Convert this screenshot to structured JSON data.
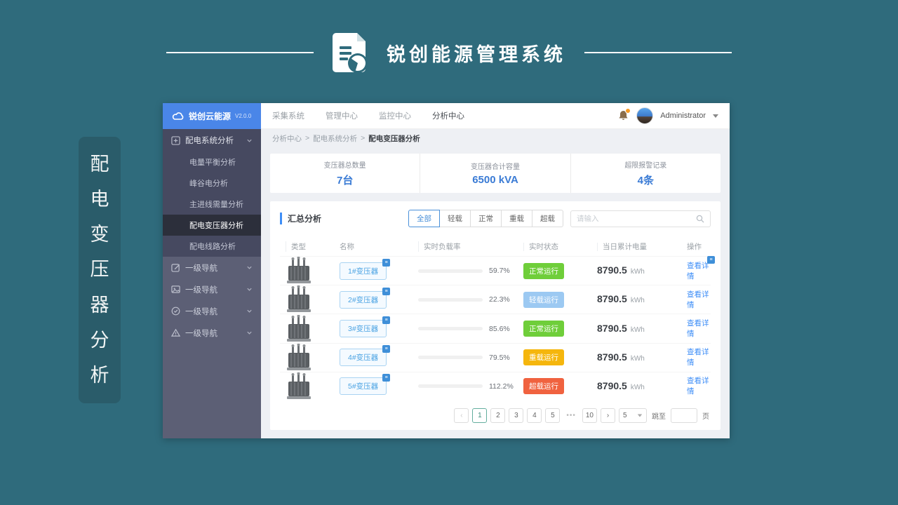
{
  "banner": {
    "title": "锐创能源管理系统"
  },
  "side_tag": {
    "chars": [
      "配",
      "电",
      "变",
      "压",
      "器",
      "分",
      "析"
    ]
  },
  "colors": {
    "page_bg": "#2f6b7c",
    "accent_blue": "#3e8ef7",
    "stat_blue": "#3a7bd5",
    "sidebar_logo": "#4a86e8",
    "status_normal": "#6fce3a",
    "status_light": "#9cc9f2",
    "status_heavy": "#f5b60d",
    "status_over": "#f0623f",
    "pager_active": "#63ae9e"
  },
  "sidebar": {
    "logo": {
      "name": "锐创云能源",
      "version": "V2.0.0"
    },
    "group": {
      "label": "配电系统分析",
      "children": [
        "电量平衡分析",
        "峰谷电分析",
        "主进线需量分析",
        "配电变压器分析",
        "配电线路分析"
      ],
      "active": "配电变压器分析"
    },
    "nav_items": [
      "一级导航",
      "一级导航",
      "一级导航",
      "一级导航"
    ]
  },
  "topnav": {
    "items": [
      "采集系统",
      "管理中心",
      "监控中心",
      "分析中心"
    ],
    "active": "分析中心",
    "user": "Administrator"
  },
  "breadcrumb": {
    "items": [
      "分析中心",
      "配电系统分析",
      "配电变压器分析"
    ],
    "separator": ">"
  },
  "stats": [
    {
      "label": "变压器总数量",
      "value": "7台"
    },
    {
      "label": "变压器合计容量",
      "value": "6500 kVA"
    },
    {
      "label": "超限报警记录",
      "value": "4条"
    }
  ],
  "summary": {
    "title": "汇总分析",
    "filters": [
      "全部",
      "轻载",
      "正常",
      "重载",
      "超载"
    ],
    "active_filter": "全部",
    "search_placeholder": "请输入",
    "table": {
      "headers": [
        "类型",
        "名称",
        "实时负载率",
        "实时状态",
        "当日累计电量",
        "操作"
      ],
      "rows": [
        {
          "name": "1#变压器",
          "load": "59.7%",
          "load_pct": 59.7,
          "status": "正常运行",
          "status_type": "normal",
          "energy": "8790.5",
          "unit": "kWh",
          "action": "查看详情"
        },
        {
          "name": "2#变压器",
          "load": "22.3%",
          "load_pct": 22.3,
          "status": "轻载运行",
          "status_type": "light",
          "energy": "8790.5",
          "unit": "kWh",
          "action": "查看详情"
        },
        {
          "name": "3#变压器",
          "load": "85.6%",
          "load_pct": 85.6,
          "status": "正常运行",
          "status_type": "normal",
          "energy": "8790.5",
          "unit": "kWh",
          "action": "查看详情"
        },
        {
          "name": "4#变压器",
          "load": "79.5%",
          "load_pct": 79.5,
          "status": "重载运行",
          "status_type": "heavy",
          "energy": "8790.5",
          "unit": "kWh",
          "action": "查看详情"
        },
        {
          "name": "5#变压器",
          "load": "112.2%",
          "load_pct": 112.2,
          "status": "超载运行",
          "status_type": "over",
          "energy": "8790.5",
          "unit": "kWh",
          "action": "查看详情"
        }
      ]
    },
    "pagination": {
      "prev": "‹",
      "next": "›",
      "pages": [
        "1",
        "2",
        "3",
        "4",
        "5"
      ],
      "ellipsis": "•••",
      "last_page": "10",
      "active_page": "1",
      "page_size": "5",
      "jump_label": "跳至",
      "page_label": "页"
    }
  }
}
